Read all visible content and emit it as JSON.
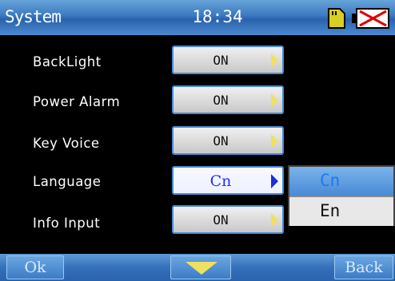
{
  "header": {
    "title": "System",
    "time": "18:34",
    "icons": [
      "sd-card-icon",
      "battery-not-charging-icon"
    ]
  },
  "settings": [
    {
      "label": "BackLight",
      "value": "ON"
    },
    {
      "label": "Power Alarm",
      "value": "ON"
    },
    {
      "label": "Key Voice",
      "value": "ON"
    },
    {
      "label": "Language",
      "value": "Cn"
    },
    {
      "label": "Info Input",
      "value": "ON"
    }
  ],
  "language_dropdown": {
    "options": [
      "Cn",
      "En"
    ],
    "selected": "Cn"
  },
  "footer": {
    "ok_label": "Ok",
    "back_label": "Back",
    "down_icon": "down-arrow-icon"
  },
  "colors": {
    "accent_blue": "#3b78c0",
    "arrow_yellow": "#f0e060",
    "selected_text": "#2030ff"
  }
}
